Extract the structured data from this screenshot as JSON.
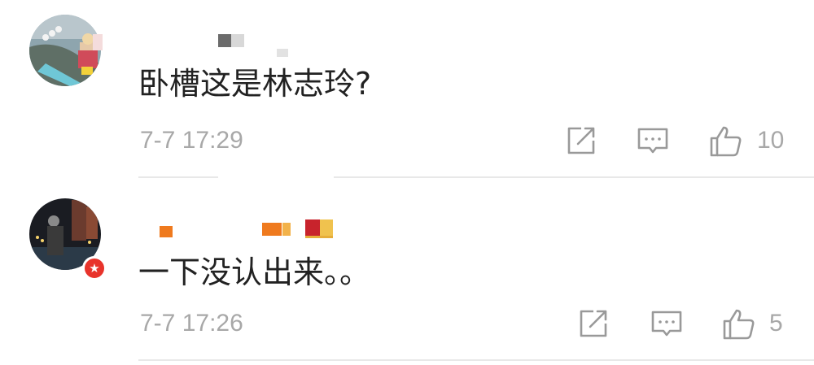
{
  "comments": [
    {
      "text": "卧槽这是林志玲?",
      "timestamp": "7-7 17:29",
      "likes": "10",
      "verified": false
    },
    {
      "text": "一下没认出来。。",
      "timestamp": "7-7 17:26",
      "likes": "5",
      "verified": true
    }
  ],
  "icons": {
    "share": "share-icon",
    "comment": "comment-icon",
    "like": "thumbs-up-icon",
    "verified": "verified-star-icon"
  },
  "colors": {
    "text": "#222222",
    "meta": "#a8a8a8",
    "icon": "#999999",
    "divider": "#e8e8e8",
    "verified_badge": "#e8332b"
  }
}
